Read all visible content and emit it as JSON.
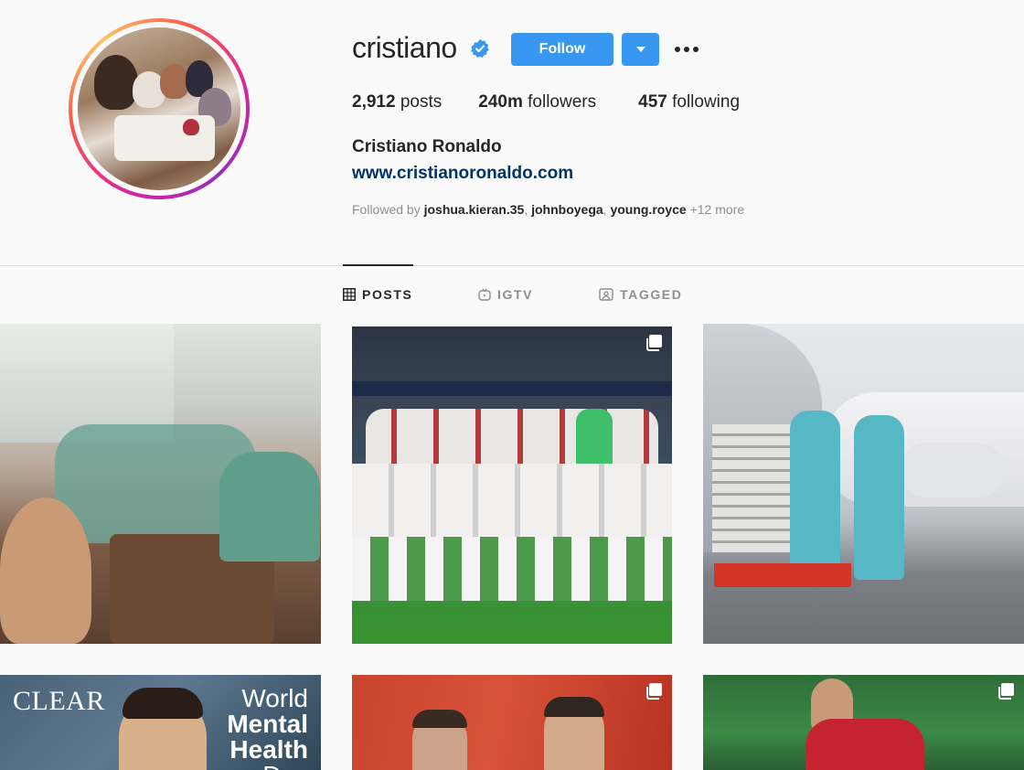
{
  "profile": {
    "username": "cristiano",
    "verified": true,
    "follow_label": "Follow",
    "stats": [
      {
        "value": "2,912",
        "label": "posts"
      },
      {
        "value": "240m",
        "label": "followers"
      },
      {
        "value": "457",
        "label": "following"
      }
    ],
    "full_name": "Cristiano Ronaldo",
    "website": "www.cristianoronaldo.com",
    "followed_by": {
      "prefix": "Followed by",
      "users": [
        "joshua.kieran.35",
        "johnboyega",
        "young.royce"
      ],
      "more": "+12 more"
    }
  },
  "tabs": [
    {
      "label": "POSTS",
      "icon": "grid-icon",
      "active": true
    },
    {
      "label": "IGTV",
      "icon": "igtv-icon",
      "active": false
    },
    {
      "label": "TAGGED",
      "icon": "tagged-icon",
      "active": false
    }
  ],
  "posts": [
    {
      "alt": "team-dinner-selfie",
      "multi": false
    },
    {
      "alt": "portugal-team-photo",
      "multi": true
    },
    {
      "alt": "players-at-private-jet",
      "multi": false
    },
    {
      "alt": "clear-ad",
      "multi": false,
      "overlay": {
        "brand": "CLEAR",
        "lines": [
          "World",
          "Mental",
          "Health",
          "Day"
        ]
      }
    },
    {
      "alt": "match-photo",
      "multi": true
    },
    {
      "alt": "on-pitch",
      "multi": true
    }
  ],
  "colors": {
    "accent": "#3897f0",
    "link": "#003569",
    "muted": "#8e8e8e",
    "verified": "#3897f0"
  }
}
